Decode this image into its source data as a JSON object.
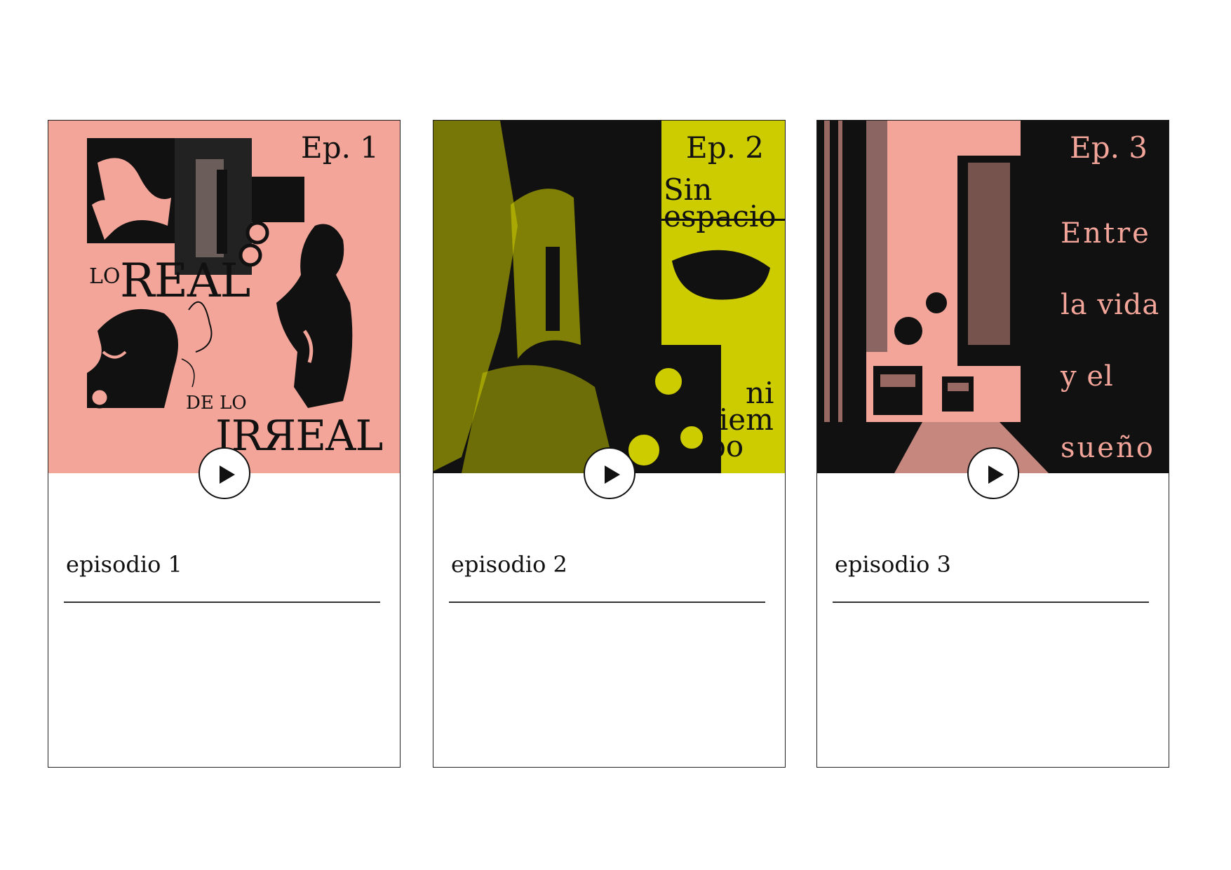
{
  "colors": {
    "pink": "#f4a59a",
    "olive": "#cccc00",
    "black": "#111111",
    "white": "#ffffff"
  },
  "episodes": [
    {
      "ep_label": "Ep. 1",
      "cover_text": {
        "lo": "LO",
        "real": "REAL",
        "de_lo": "DE LO",
        "irreal": "IRЯEAL"
      },
      "title": "episodio 1",
      "play_icon": "play-icon"
    },
    {
      "ep_label": "Ep. 2",
      "cover_text": {
        "line1": "Sin",
        "line2": "espacio",
        "line3": "ni",
        "line4": "tiem",
        "line5": "po"
      },
      "title": "episodio 2",
      "play_icon": "play-icon"
    },
    {
      "ep_label": "Ep. 3",
      "cover_text": {
        "line1": "Entre",
        "line2": "la vida",
        "line3": "y el",
        "line4": "sueño"
      },
      "title": "episodio 3",
      "play_icon": "play-icon"
    }
  ]
}
